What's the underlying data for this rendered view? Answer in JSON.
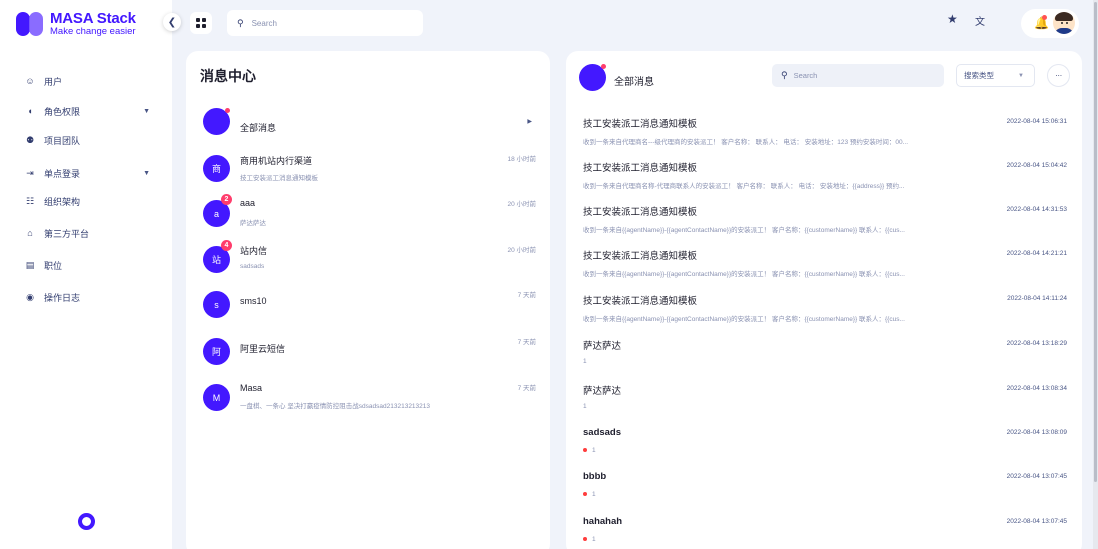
{
  "brand": {
    "title": "MASA Stack",
    "subtitle": "Make change easier"
  },
  "icons": {
    "collapse": "chevron-left-icon",
    "grid": "grid-icon",
    "star": "star-icon",
    "translate": "translate-icon",
    "bell": "bell-icon"
  },
  "colors": {
    "accent": "#4318ff",
    "badge": "#ff3d6c",
    "background": "#f0f3fa"
  },
  "sidebar": {
    "items": [
      {
        "label": "用户",
        "icon": "user-icon",
        "has_children": false
      },
      {
        "label": "角色权限",
        "icon": "shield-icon",
        "has_children": true
      },
      {
        "label": "项目团队",
        "icon": "team-icon",
        "has_children": false
      },
      {
        "label": "单点登录",
        "icon": "login-icon",
        "has_children": true
      },
      {
        "label": "组织架构",
        "icon": "org-icon",
        "has_children": false
      },
      {
        "label": "第三方平台",
        "icon": "home-icon",
        "has_children": false
      },
      {
        "label": "职位",
        "icon": "position-icon",
        "has_children": false
      },
      {
        "label": "操作日志",
        "icon": "log-icon",
        "has_children": false
      }
    ]
  },
  "topbar": {
    "search_placeholder": "Search"
  },
  "left_panel": {
    "title": "消息中心",
    "conversations": [
      {
        "avatar": "",
        "name": "全部消息",
        "preview": "",
        "time": "",
        "badge": "",
        "dot": true,
        "arrow": true
      },
      {
        "avatar": "商",
        "name": "商用机站内行渠道",
        "preview": "技工安装派工消息通知模板",
        "time": "18 小时前",
        "badge": "",
        "dot": false,
        "arrow": false
      },
      {
        "avatar": "a",
        "name": "aaa",
        "preview": "萨达萨达",
        "time": "20 小时前",
        "badge": "2",
        "dot": false,
        "arrow": false
      },
      {
        "avatar": "站",
        "name": "站内信",
        "preview": "sadsads",
        "time": "20 小时前",
        "badge": "4",
        "dot": false,
        "arrow": false
      },
      {
        "avatar": "s",
        "name": "sms10",
        "preview": "",
        "time": "7 天前",
        "badge": "",
        "dot": false,
        "arrow": false
      },
      {
        "avatar": "阿",
        "name": "阿里云短信",
        "preview": "",
        "time": "7 天前",
        "badge": "",
        "dot": false,
        "arrow": false
      },
      {
        "avatar": "M",
        "name": "Masa",
        "preview": "一盘棋、一条心 坚决打赢疫情防控阻击战sdsadsad213213213213",
        "time": "7 天前",
        "badge": "",
        "dot": false,
        "arrow": false
      }
    ]
  },
  "right_panel": {
    "title": "全部消息",
    "search_placeholder": "Search",
    "filter_placeholder": "搜索类型",
    "more_label": "···",
    "messages": [
      {
        "title": "技工安装派工消息通知模板",
        "date": "2022-08-04 15:06:31",
        "content": "收到一条来自代理商名---级代理商的安装派工！ 客户名称： 联系人： 电话： 安装地址：123 预约安装时间：00...",
        "unread": false,
        "bold": false
      },
      {
        "title": "技工安装派工消息通知模板",
        "date": "2022-08-04 15:04:42",
        "content": "收到一条来自代理商名称-代理商联系人的安装派工！ 客户名称： 联系人： 电话： 安装地址：{{address}} 预约...",
        "unread": false,
        "bold": false
      },
      {
        "title": "技工安装派工消息通知模板",
        "date": "2022-08-04 14:31:53",
        "content": "收到一条来自{{agentName}}-{{agentContactName}}的安装派工！ 客户名称：{{customerName}} 联系人：{{cus...",
        "unread": false,
        "bold": false
      },
      {
        "title": "技工安装派工消息通知模板",
        "date": "2022-08-04 14:21:21",
        "content": "收到一条来自{{agentName}}-{{agentContactName}}的安装派工！ 客户名称：{{customerName}} 联系人：{{cus...",
        "unread": false,
        "bold": false
      },
      {
        "title": "技工安装派工消息通知模板",
        "date": "2022-08-04 14:11:24",
        "content": "收到一条来自{{agentName}}-{{agentContactName}}的安装派工！ 客户名称：{{customerName}} 联系人：{{cus...",
        "unread": false,
        "bold": false
      },
      {
        "title": "萨达萨达",
        "date": "2022-08-04 13:18:29",
        "content": "1",
        "unread": false,
        "bold": false
      },
      {
        "title": "萨达萨达",
        "date": "2022-08-04 13:08:34",
        "content": "1",
        "unread": false,
        "bold": false
      },
      {
        "title": "sadsads",
        "date": "2022-08-04 13:08:09",
        "content": "1",
        "unread": true,
        "bold": true
      },
      {
        "title": "bbbb",
        "date": "2022-08-04 13:07:45",
        "content": "1",
        "unread": true,
        "bold": true
      },
      {
        "title": "hahahah",
        "date": "2022-08-04 13:07:45",
        "content": "1",
        "unread": true,
        "bold": true
      }
    ]
  }
}
